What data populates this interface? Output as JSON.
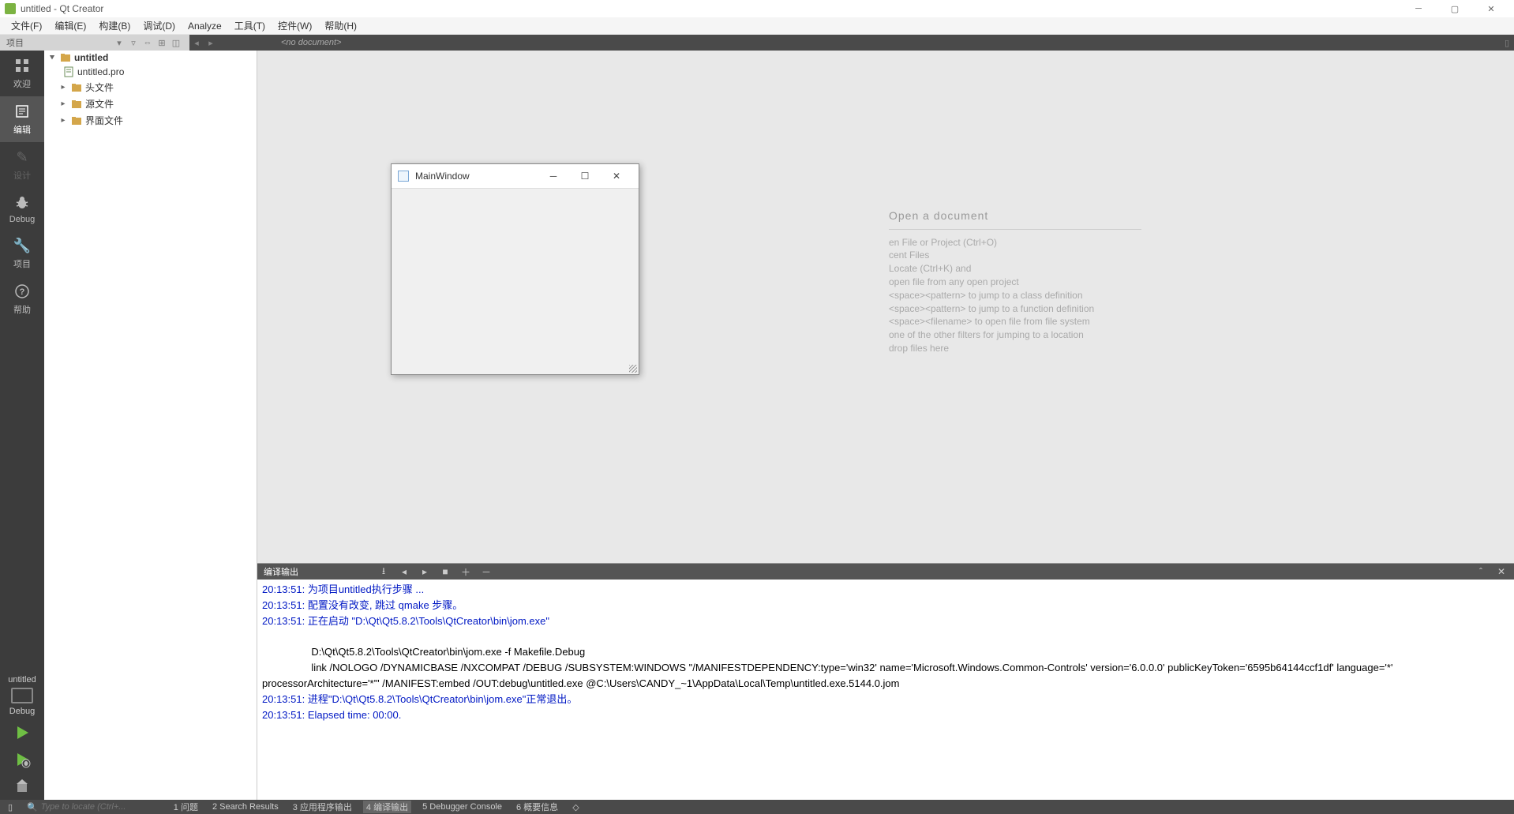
{
  "window": {
    "title": "untitled - Qt Creator"
  },
  "menubar": {
    "items": [
      "文件(F)",
      "编辑(E)",
      "构建(B)",
      "调试(D)",
      "Analyze",
      "工具(T)",
      "控件(W)",
      "帮助(H)"
    ]
  },
  "toptoolbar": {
    "project_label": "项目",
    "no_document": "<no document>"
  },
  "modebar": {
    "items": [
      {
        "label": "欢迎",
        "icon": "grid"
      },
      {
        "label": "编辑",
        "icon": "edit",
        "active": true
      },
      {
        "label": "设计",
        "icon": "pencil",
        "disabled": true
      },
      {
        "label": "Debug",
        "icon": "bug"
      },
      {
        "label": "项目",
        "icon": "wrench"
      },
      {
        "label": "帮助",
        "icon": "help"
      }
    ],
    "target": "untitled",
    "config": "Debug"
  },
  "project_tree": {
    "root": "untitled",
    "pro_file": "untitled.pro",
    "folders": [
      "头文件",
      "源文件",
      "界面文件"
    ]
  },
  "editor_hints": {
    "title": "Open a document",
    "lines": [
      "en File or Project (Ctrl+O)",
      "cent Files",
      "Locate (Ctrl+K) and",
      " open file from any open project",
      "<space><pattern> to jump to a class definition",
      "<space><pattern> to jump to a function definition",
      "<space><filename> to open file from file system",
      "one of the other filters for jumping to a location",
      "drop files here"
    ]
  },
  "mainwindow_dialog": {
    "title": "MainWindow"
  },
  "compile_output": {
    "title": "编译输出",
    "lines_blue": [
      "20:13:51: 为项目untitled执行步骤 ...",
      "20:13:51: 配置没有改变, 跳过 qmake 步骤。",
      "20:13:51: 正在启动 \"D:\\Qt\\Qt5.8.2\\Tools\\QtCreator\\bin\\jom.exe\""
    ],
    "lines_black": [
      "",
      "\tD:\\Qt\\Qt5.8.2\\Tools\\QtCreator\\bin\\jom.exe -f Makefile.Debug",
      "\tlink /NOLOGO /DYNAMICBASE /NXCOMPAT /DEBUG /SUBSYSTEM:WINDOWS \"/MANIFESTDEPENDENCY:type='win32' name='Microsoft.Windows.Common-Controls' version='6.0.0.0' publicKeyToken='6595b64144ccf1df' language='*' processorArchitecture='*'\" /MANIFEST:embed /OUT:debug\\untitled.exe @C:\\Users\\CANDY_~1\\AppData\\Local\\Temp\\untitled.exe.5144.0.jom"
    ],
    "lines_blue2": [
      "20:13:51: 进程\"D:\\Qt\\Qt5.8.2\\Tools\\QtCreator\\bin\\jom.exe\"正常退出。",
      "20:13:51: Elapsed time: 00:00."
    ]
  },
  "statusbar": {
    "locate_placeholder": "Type to locate (Ctrl+...",
    "tabs": [
      "1 问题",
      "2 Search Results",
      "3 应用程序输出",
      "4 编译输出",
      "5 Debugger Console",
      "6 概要信息"
    ]
  }
}
